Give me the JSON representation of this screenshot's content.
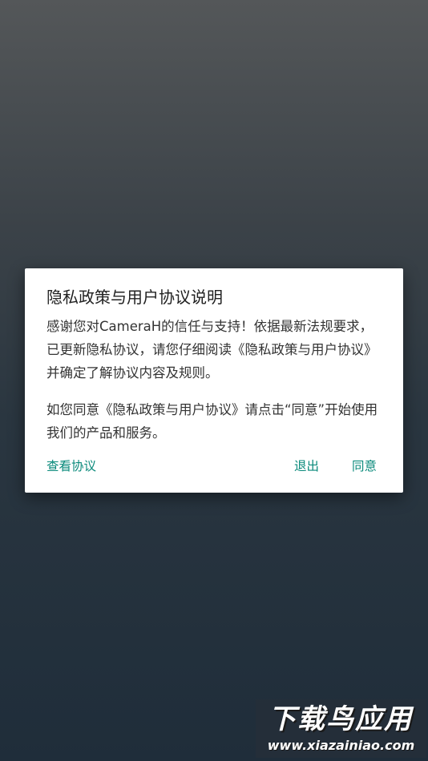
{
  "dialog": {
    "title": "隐私政策与用户协议说明",
    "paragraph1": "感谢您对CameraH的信任与支持！依据最新法规要求，已更新隐私协议，请您仔细阅读《隐私政策与用户协议》并确定了解协议内容及规则。",
    "paragraph2": "如您同意《隐私政策与用户协议》请点击“同意”开始使用我们的产品和服务。",
    "buttons": {
      "view": "查看协议",
      "exit": "退出",
      "agree": "同意"
    }
  },
  "watermark": {
    "title": "下载鸟应用",
    "url": "www.xiazainiao.com"
  },
  "colors": {
    "accent": "#0a8a7b",
    "dialog_bg": "#ffffff",
    "scrim_top": "#545759",
    "scrim_bottom": "#1f2d3a"
  }
}
